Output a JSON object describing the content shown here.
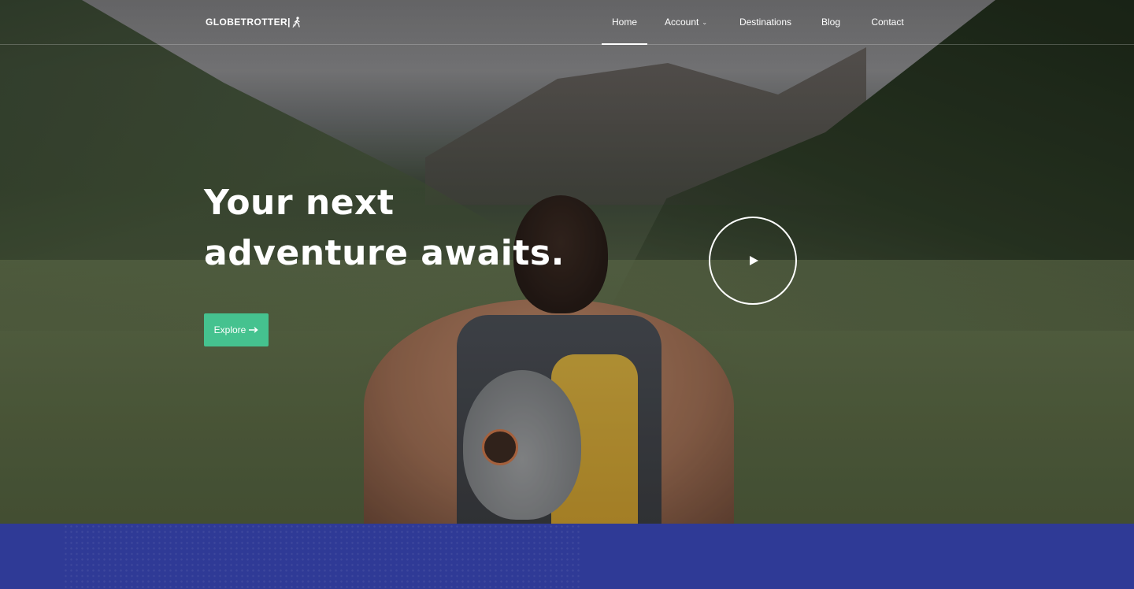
{
  "brand": {
    "name": "GLOBETROTTER|"
  },
  "nav": {
    "items": [
      {
        "label": "Home",
        "active": true
      },
      {
        "label": "Account",
        "has_dropdown": true
      },
      {
        "label": "Destinations"
      },
      {
        "label": "Blog"
      },
      {
        "label": "Contact"
      }
    ]
  },
  "hero": {
    "headline": "Your next adventure awaits.",
    "cta_label": "Explore",
    "cta_icon": "arrow-right-icon",
    "play_icon": "play-icon"
  },
  "colors": {
    "accent": "#45c28f",
    "band": "#2f3a96",
    "text": "#ffffff"
  }
}
